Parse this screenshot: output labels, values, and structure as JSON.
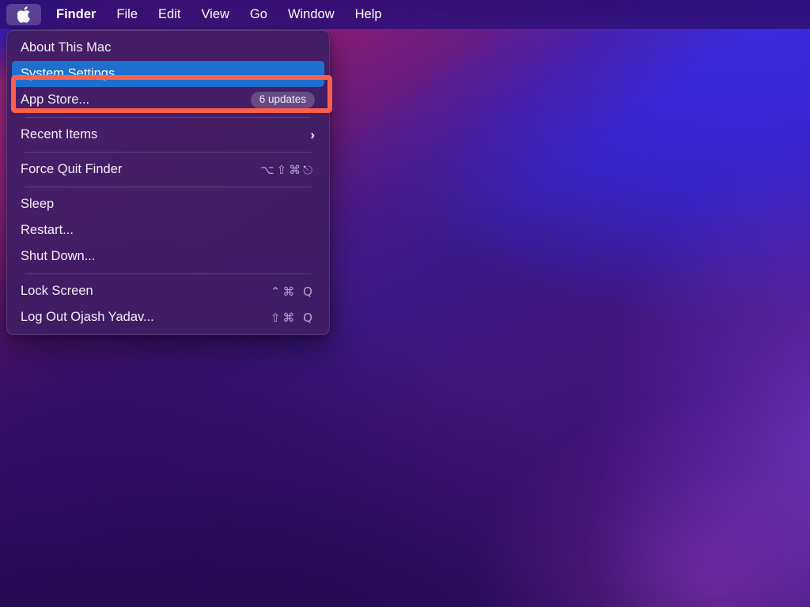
{
  "menu_bar": {
    "apple_icon": "apple-logo-icon",
    "items": [
      {
        "label": "Finder",
        "bold": true
      },
      {
        "label": "File",
        "bold": false
      },
      {
        "label": "Edit",
        "bold": false
      },
      {
        "label": "View",
        "bold": false
      },
      {
        "label": "Go",
        "bold": false
      },
      {
        "label": "Window",
        "bold": false
      },
      {
        "label": "Help",
        "bold": false
      }
    ]
  },
  "apple_menu": {
    "items": [
      {
        "label": "About This Mac",
        "right": "",
        "selected": false
      },
      {
        "label": "System Settings...",
        "right": "",
        "selected": true
      },
      {
        "label": "App Store...",
        "badge": "6 updates",
        "selected": false
      },
      {
        "label": "Recent Items",
        "chevron": "›",
        "selected": false
      },
      {
        "label": "Force Quit Finder",
        "right": "⌥⇧⌘⎋",
        "selected": false
      },
      {
        "label": "Sleep",
        "right": "",
        "selected": false
      },
      {
        "label": "Restart...",
        "right": "",
        "selected": false
      },
      {
        "label": "Shut Down...",
        "right": "",
        "selected": false
      },
      {
        "label": "Lock Screen",
        "right": "⌃⌘ Q",
        "selected": false
      },
      {
        "label": "Log Out Ojash Yadav...",
        "right": "⇧⌘ Q",
        "selected": false
      }
    ]
  },
  "annotation": {
    "target_label": "System Settings...",
    "color": "#fd5f4d"
  },
  "colors": {
    "menubar_bg": "#2c0e70",
    "menu_bg": "#3e1e64",
    "selection_blue": "#1f6fce",
    "annotation_red": "#fd5f4d",
    "text": "#f2eef8",
    "shortcut_text": "#b3a5cd"
  }
}
